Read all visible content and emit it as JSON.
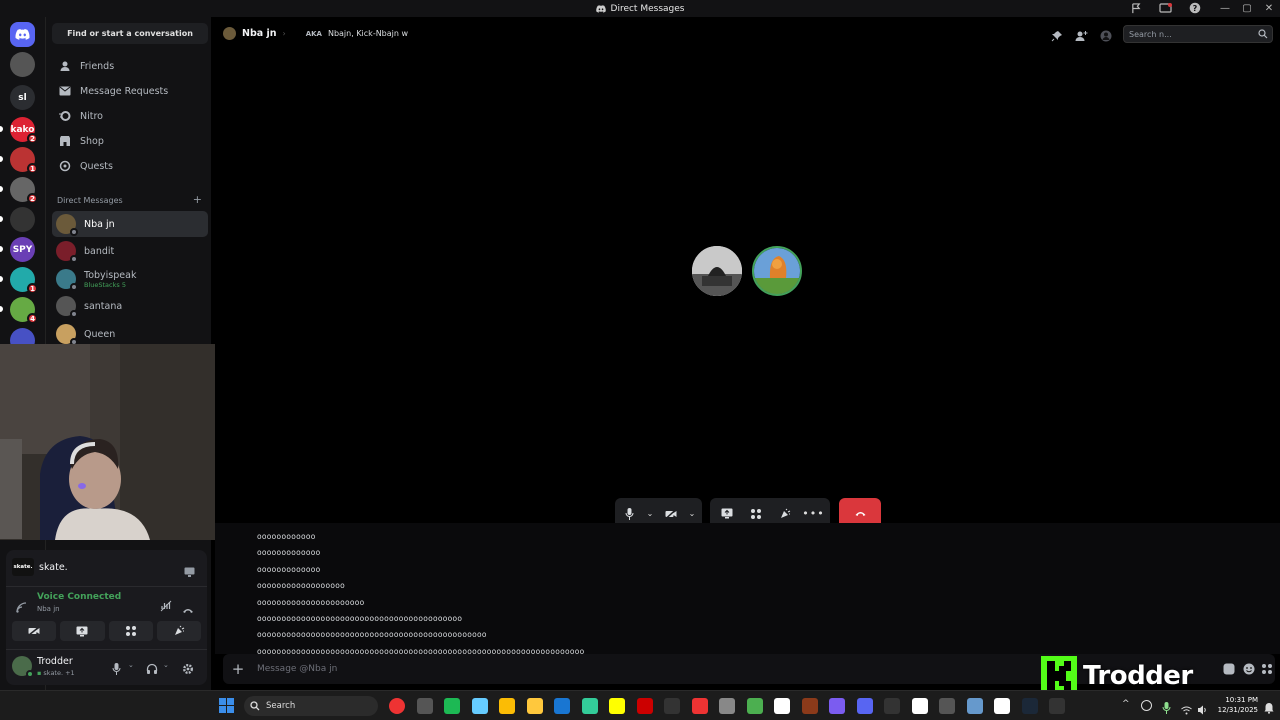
{
  "titlebar": {
    "title": "Direct Messages",
    "icons": [
      "inbox-icon",
      "screen-icon",
      "help-icon"
    ],
    "window_controls": [
      "—",
      "▢",
      "✕"
    ]
  },
  "rail": {
    "home_icon": "discord-logo-icon",
    "servers": [
      {
        "label": "",
        "badge": "",
        "color": "#555"
      },
      {
        "label": "sl",
        "badge": "",
        "color": "#2b2d31"
      },
      {
        "label": "kako",
        "badge": "2",
        "color": "#d23"
      },
      {
        "label": "",
        "badge": "1",
        "color": "#b33"
      },
      {
        "label": "",
        "badge": "2",
        "color": "#666"
      },
      {
        "label": "",
        "badge": "",
        "color": "#333"
      },
      {
        "label": "SPY",
        "badge": "",
        "color": "#6a3fb5"
      },
      {
        "label": "",
        "badge": "1",
        "color": "#2aa"
      },
      {
        "label": "",
        "badge": "4",
        "color": "#6a4"
      },
      {
        "label": "",
        "badge": "",
        "color": "#4751c4"
      }
    ]
  },
  "sidebar": {
    "find_label": "Find or start a conversation",
    "nav": [
      {
        "label": "Friends",
        "icon": "friends-icon"
      },
      {
        "label": "Message Requests",
        "icon": "mail-icon"
      },
      {
        "label": "Nitro",
        "icon": "nitro-icon"
      },
      {
        "label": "Shop",
        "icon": "shop-icon"
      },
      {
        "label": "Quests",
        "icon": "quests-icon"
      }
    ],
    "dm_header": "Direct Messages",
    "dm_add": "+",
    "dms": [
      {
        "name": "Nba jn",
        "sub": "",
        "active": true,
        "color": "#6b5a3a"
      },
      {
        "name": "bandit",
        "sub": "",
        "active": false,
        "color": "#7a1e2a"
      },
      {
        "name": "Tobyispeak",
        "sub": "BlueStacks 5",
        "active": false,
        "color": "#3a7a8a"
      },
      {
        "name": "santana",
        "sub": "",
        "active": false,
        "color": "#555"
      },
      {
        "name": "Queen",
        "sub": "",
        "active": false,
        "color": "#c8a060"
      }
    ]
  },
  "userpanel": {
    "activity": "skate.",
    "activity_logo": "skate.",
    "voice_status": "Voice Connected",
    "voice_channel": "Nba jn",
    "user_name": "Trodder",
    "user_status": "skate. +1"
  },
  "chat": {
    "recipient": "Nba jn",
    "aka_label": "AKA",
    "aka_names": "Nbajn, Kick-Nbajn w",
    "search_placeholder": "Search n...",
    "messages": [
      "oooooooooooo",
      "ooooooooooooo",
      "ooooooooooooo",
      "oooooooooooooooooo",
      "oooooooooooooooooooooo",
      "oooooooooooooooooooooooooooooooooooooooooo",
      "ooooooooooooooooooooooooooooooooooooooooooooooo",
      "ooooooooooooooooooooooooooooooooooooooooooooooooooooooooooooooooooo"
    ],
    "composer_placeholder": "Message @Nba jn"
  },
  "overlay": {
    "streamer_name": "Trodder"
  },
  "taskbar": {
    "search_label": "Search",
    "time": "10:31 PM",
    "date": "12/31/2025",
    "apps": [
      "#e33",
      "#555",
      "#1db954",
      "#6cf",
      "#fbbc05",
      "#ffc83d",
      "#1976d2",
      "#3c9",
      "#ff0",
      "#c00",
      "#333",
      "#e33",
      "#888",
      "#4caf50",
      "#fff",
      "#8b3a1a",
      "#7b5cf0",
      "#5865f2",
      "#333",
      "#fff",
      "#555",
      "#69c",
      "#fff",
      "#1b2838",
      "#333"
    ]
  }
}
